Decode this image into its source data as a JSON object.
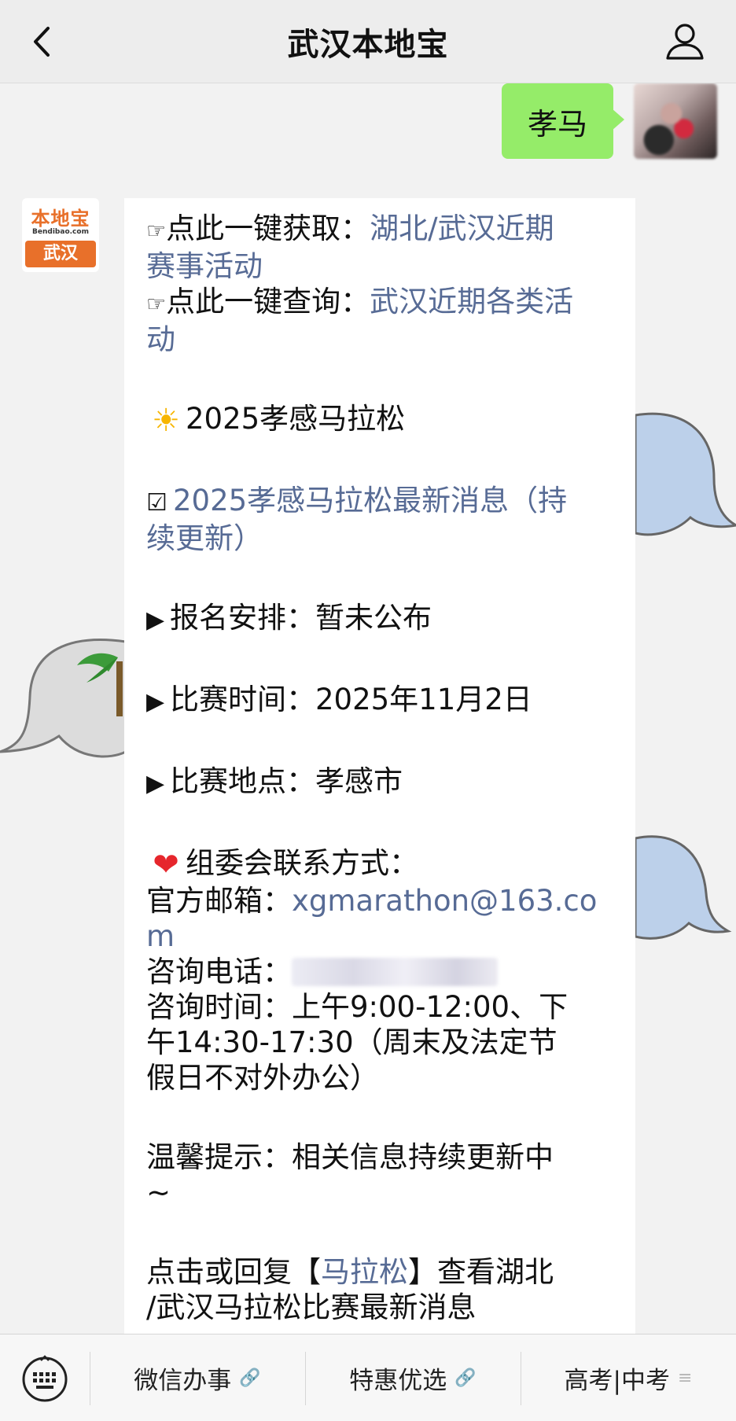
{
  "header": {
    "title": "武汉本地宝",
    "back_icon": "chevron-left-icon",
    "user_icon": "person-icon"
  },
  "sent_message": {
    "text": "孝马",
    "bubble_color": "#95ec69"
  },
  "bot": {
    "avatar_brand": "本地宝",
    "avatar_brand_sub": "Bendibao.com",
    "avatar_city": "武汉",
    "brand_color": "#e8702a"
  },
  "message": {
    "link_color": "#576b95",
    "l1_prefix": "点此一键获取：",
    "l1_link_a": "湖北/武汉近期",
    "l1_link_b": "赛事活动",
    "l2_prefix": "点此一键查询：",
    "l2_link_a": "武汉近期各类活",
    "l2_link_b": "动",
    "headline": "2025孝感马拉松",
    "news_link_a": "2025孝感马拉松最新消息（持",
    "news_link_b": "续更新）",
    "signup_label": "报名安排：",
    "signup_value": "暂未公布",
    "time_label": "比赛时间：",
    "time_value": "2025年11月2日",
    "place_label": "比赛地点：",
    "place_value": "孝感市",
    "contact_title": "组委会联系方式：",
    "email_label": "官方邮箱：",
    "email_a": "xgmarathon@163.co",
    "email_b": "m",
    "phone_label": "咨询电话：",
    "hours_a": "咨询时间：上午9:00-12:00、下",
    "hours_b": "午14:30-17:30（周末及法定节",
    "hours_c": "假日不对外办公）",
    "tip_a": "温馨提示：相关信息持续更新中",
    "tip_b": "~",
    "cta_prefix": "点击或回复【",
    "cta_link": "马拉松",
    "cta_suffix": "】查看湖北",
    "cta_b": "/武汉马拉松比赛最新消息"
  },
  "menu": {
    "keyboard_icon": "keyboard-icon",
    "item1": "微信办事",
    "item2": "特惠优选",
    "item3": "高考|中考"
  }
}
